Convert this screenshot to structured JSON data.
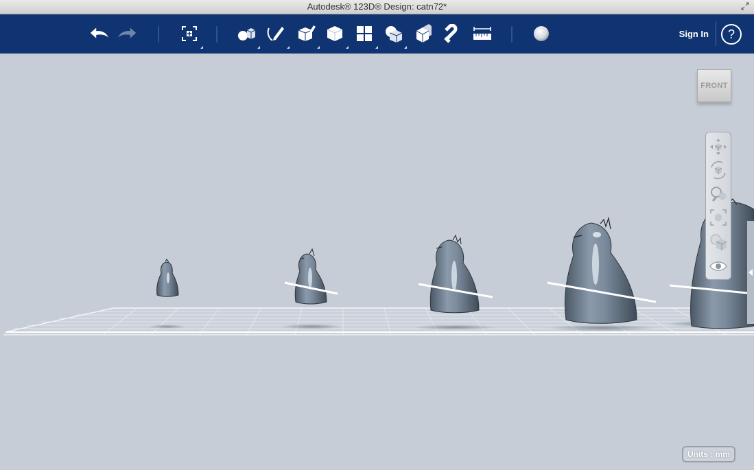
{
  "window": {
    "title": "Autodesk® 123D® Design: catn72*"
  },
  "toolbar": {
    "tools": [
      {
        "name": "undo-button",
        "icon": "undo-arrow-icon"
      },
      {
        "name": "redo-button",
        "icon": "redo-arrow-icon"
      },
      {
        "name": "transform-button",
        "icon": "transform-icon"
      },
      {
        "name": "primitives-button",
        "icon": "primitives-icon"
      },
      {
        "name": "sketch-button",
        "icon": "sketch-icon"
      },
      {
        "name": "construct-button",
        "icon": "construct-icon"
      },
      {
        "name": "modify-button",
        "icon": "modify-icon"
      },
      {
        "name": "pattern-button",
        "icon": "pattern-icon"
      },
      {
        "name": "grouping-button",
        "icon": "grouping-icon"
      },
      {
        "name": "combine-button",
        "icon": "combine-icon"
      },
      {
        "name": "snap-button",
        "icon": "magnet-icon"
      },
      {
        "name": "measure-button",
        "icon": "ruler-icon"
      },
      {
        "name": "material-button",
        "icon": "sphere-icon"
      }
    ],
    "sign_in": "Sign In",
    "help": "?"
  },
  "viewcube": {
    "face_label": "FRONT"
  },
  "navbar": {
    "items": [
      {
        "name": "pan-button",
        "icon": "pan-icon"
      },
      {
        "name": "orbit-button",
        "icon": "orbit-icon"
      },
      {
        "name": "zoom-button",
        "icon": "zoom-icon"
      },
      {
        "name": "fit-button",
        "icon": "fit-icon"
      },
      {
        "name": "view-mode-button",
        "icon": "perspective-icon"
      },
      {
        "name": "visibility-button",
        "icon": "eye-icon"
      }
    ]
  },
  "status": {
    "units": "Units : mm"
  },
  "colors": {
    "toolbar_bg": "#0f3471",
    "viewport_bg": "#c6cdd6",
    "model_fill": "#6b7b8b"
  }
}
